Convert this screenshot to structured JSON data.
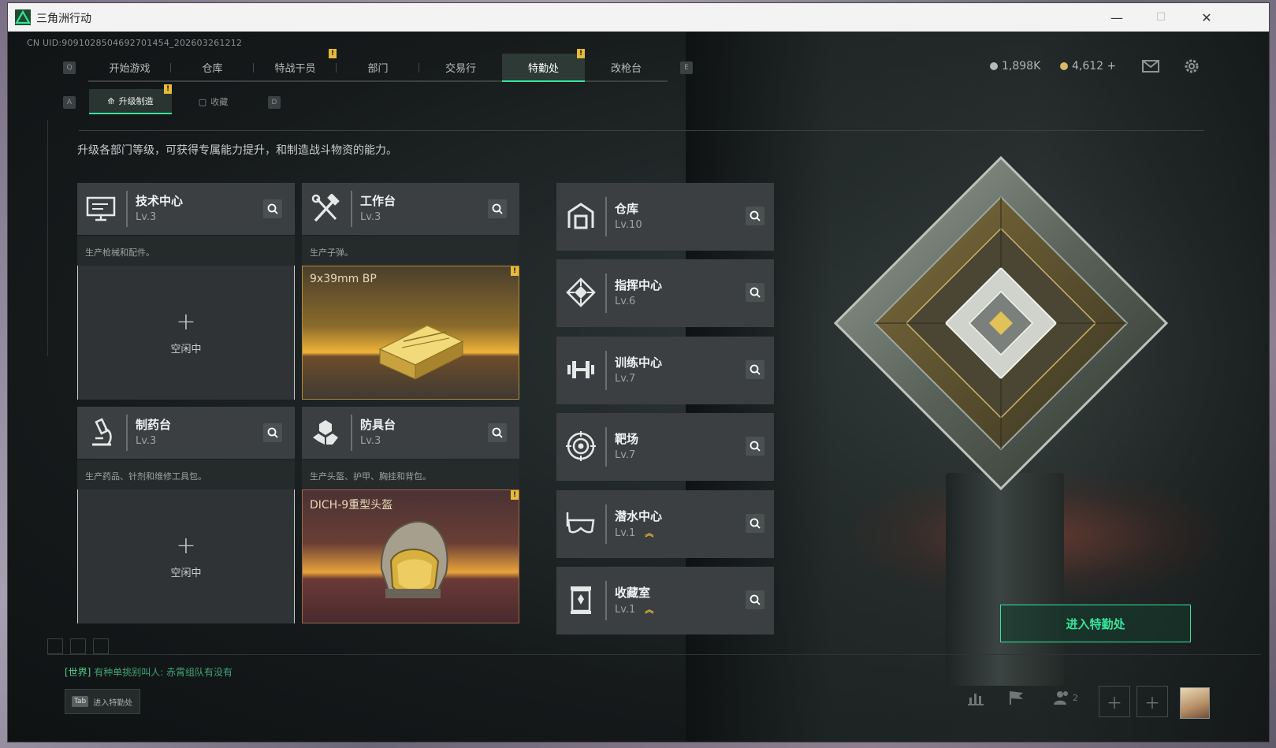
{
  "window": {
    "title": "三角洲行动",
    "minimize_glyph": "—",
    "maximize_glyph": "☐",
    "close_glyph": "✕"
  },
  "header": {
    "uid": "CN UID:9091028504692701454_202603261212",
    "key_left": "Q",
    "key_right": "E",
    "tabs": [
      {
        "label": "开始游戏"
      },
      {
        "label": "仓库"
      },
      {
        "label": "特战干员",
        "badge": "!"
      },
      {
        "label": "部门"
      },
      {
        "label": "交易行"
      },
      {
        "label": "特勤处",
        "badge": "!",
        "active": true
      },
      {
        "label": "改枪台"
      }
    ],
    "currency": [
      {
        "value": "1,898K",
        "color": "#b9b9b9"
      },
      {
        "value": "4,612 +",
        "color": "#d7b96a"
      }
    ],
    "mail_icon": "mail-icon",
    "settings_icon": "gear-icon"
  },
  "subnav": {
    "key_left": "A",
    "key_right": "D",
    "tabs": [
      {
        "label": "升级制造",
        "active": true,
        "badge": "!"
      },
      {
        "label": "收藏"
      }
    ]
  },
  "description": "升级各部门等级，可获得专属能力提升，和制造战斗物资的能力。",
  "production_cards": [
    {
      "name": "技术中心",
      "level": "Lv.3",
      "subtitle": "生产枪械和配件。",
      "slot": {
        "state": "empty",
        "plus": "+",
        "label": "空闲中"
      },
      "icon": "computer-icon"
    },
    {
      "name": "工作台",
      "level": "Lv.3",
      "subtitle": "生产子弹。",
      "slot": {
        "state": "filled",
        "item": "9x39mm BP",
        "badge": "!"
      },
      "icon": "tools-icon"
    },
    {
      "name": "制药台",
      "level": "Lv.3",
      "subtitle": "生产药品、针剂和维修工具包。",
      "slot": {
        "state": "empty",
        "plus": "+",
        "label": "空闲中"
      },
      "icon": "microscope-icon"
    },
    {
      "name": "防具台",
      "level": "Lv.3",
      "subtitle": "生产头盔、护甲、胸挂和背包。",
      "slot": {
        "state": "filled",
        "item": "DICH-9重型头盔",
        "badge": "!"
      },
      "icon": "armor-icon"
    }
  ],
  "facilities": [
    {
      "name": "仓库",
      "level": "Lv.10",
      "icon": "warehouse-icon"
    },
    {
      "name": "指挥中心",
      "level": "Lv.6",
      "icon": "command-icon"
    },
    {
      "name": "训练中心",
      "level": "Lv.7",
      "icon": "dumbbell-icon"
    },
    {
      "name": "靶场",
      "level": "Lv.7",
      "icon": "target-icon"
    },
    {
      "name": "潜水中心",
      "level": "Lv.1",
      "upgradable": true,
      "icon": "goggles-icon"
    },
    {
      "name": "收藏室",
      "level": "Lv.1",
      "upgradable": true,
      "icon": "trophy-icon"
    }
  ],
  "enter_button": "进入特勤处",
  "chat": {
    "channel": "[世界]",
    "text": "有种单挑别叫人: 赤霄组队有没有"
  },
  "tab_hint": {
    "key": "Tab",
    "label": "进入特勤处"
  },
  "friends_count": "2",
  "colors": {
    "accent": "#37e39b",
    "badge": "#e8b93a"
  }
}
